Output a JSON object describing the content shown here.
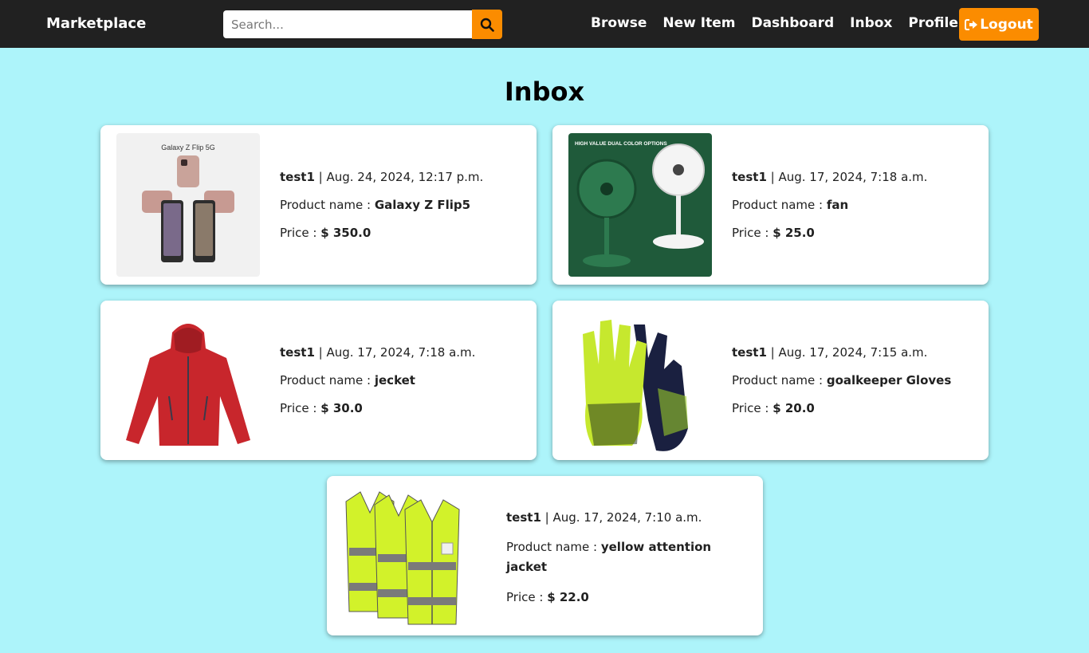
{
  "navbar": {
    "brand": "Marketplace",
    "search_placeholder": "Search...",
    "links": [
      "Browse",
      "New Item",
      "Dashboard",
      "Inbox",
      "Profile"
    ],
    "logout_label": "Logout"
  },
  "page": {
    "title": "Inbox"
  },
  "labels": {
    "product_name": "Product name : ",
    "price": "Price : ",
    "separator": " | "
  },
  "messages": [
    {
      "user": "test1",
      "date": "Aug. 24, 2024, 12:17 p.m.",
      "product": "Galaxy Z Flip5",
      "price": "$ 350.0",
      "image_caption": "Galaxy Z Flip 5G"
    },
    {
      "user": "test1",
      "date": "Aug. 17, 2024, 7:18 a.m.",
      "product": "fan",
      "price": "$ 25.0",
      "image_caption": "HIGH VALUE DUAL COLOR OPTIONS"
    },
    {
      "user": "test1",
      "date": "Aug. 17, 2024, 7:18 a.m.",
      "product": "jecket",
      "price": "$ 30.0"
    },
    {
      "user": "test1",
      "date": "Aug. 17, 2024, 7:15 a.m.",
      "product": "goalkeeper Gloves",
      "price": "$ 20.0"
    },
    {
      "user": "test1",
      "date": "Aug. 17, 2024, 7:10 a.m.",
      "product": "yellow attention jacket",
      "price": "$ 22.0"
    }
  ],
  "colors": {
    "navbar": "#212121",
    "accent": "#fb8c00",
    "background": "#adf4fa"
  }
}
